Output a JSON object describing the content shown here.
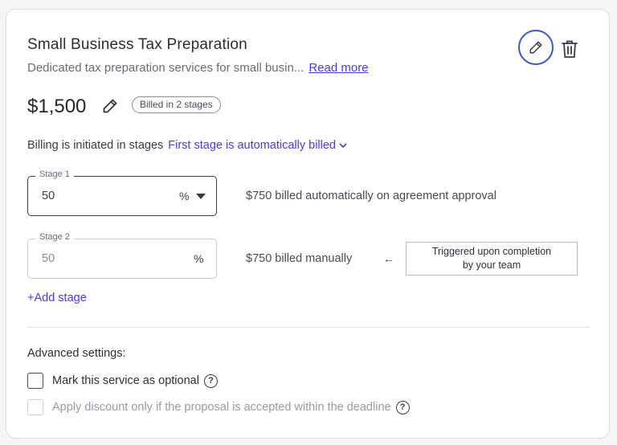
{
  "service": {
    "title": "Small Business Tax Preparation",
    "description": "Dedicated tax preparation services for small busin...",
    "read_more": "Read more",
    "price": "$1,500",
    "badge": "Billed in 2 stages"
  },
  "billing": {
    "prefix": "Billing is initiated in stages",
    "mode": "First stage is automatically billed"
  },
  "stages": [
    {
      "label": "Stage 1",
      "value": "50",
      "unit": "%",
      "note": "$750 billed automatically on agreement approval"
    },
    {
      "label": "Stage 2",
      "value": "50",
      "unit": "%",
      "note": "$750 billed manually",
      "arrow": "←",
      "tooltip_line1": "Triggered upon completion",
      "tooltip_line2": "by your team"
    }
  ],
  "add_stage": "+Add stage",
  "advanced": {
    "heading": "Advanced settings:",
    "options": [
      {
        "label": "Mark this service as optional",
        "checked": false,
        "disabled": false
      },
      {
        "label": "Apply discount only if the proposal is accepted within the deadline",
        "checked": false,
        "disabled": true
      }
    ],
    "help_glyph": "?"
  },
  "colors": {
    "accent": "#4b3bd6",
    "edit_ring": "#3d56c5"
  },
  "icons": {
    "edit": "pencil-icon",
    "delete": "trash-icon",
    "price_edit": "pencil-icon",
    "dropdown": "chevron-down-icon"
  }
}
